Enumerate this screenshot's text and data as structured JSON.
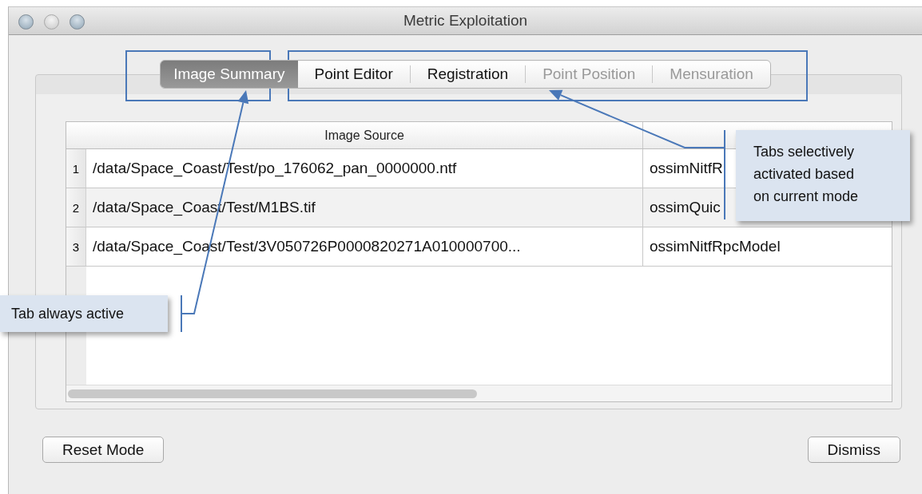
{
  "window": {
    "title": "Metric Exploitation"
  },
  "tabs": [
    {
      "label": "Image Summary",
      "selected": true,
      "disabled": false
    },
    {
      "label": "Point Editor",
      "selected": false,
      "disabled": false
    },
    {
      "label": "Registration",
      "selected": false,
      "disabled": false
    },
    {
      "label": "Point Position",
      "selected": false,
      "disabled": true
    },
    {
      "label": "Mensuration",
      "selected": false,
      "disabled": true
    }
  ],
  "table": {
    "columns": [
      "Image Source"
    ],
    "rows": [
      {
        "number": "1",
        "image_source": "/data/Space_Coast/Test/po_176062_pan_0000000.ntf",
        "column_2": "ossimNitfR"
      },
      {
        "number": "2",
        "image_source": "/data/Space_Coast/Test/M1BS.tif",
        "column_2": "ossimQuic"
      },
      {
        "number": "3",
        "image_source": "/data/Space_Coast/Test/3V050726P0000820271A010000700...",
        "column_2": "ossimNitfRpcModel"
      }
    ]
  },
  "buttons": [
    {
      "label": "Reset Mode"
    },
    {
      "label": "Dismiss"
    }
  ],
  "annotations": [
    {
      "text": "Tabs selectively activated based on current mode"
    },
    {
      "text": "Tab always active"
    }
  ]
}
